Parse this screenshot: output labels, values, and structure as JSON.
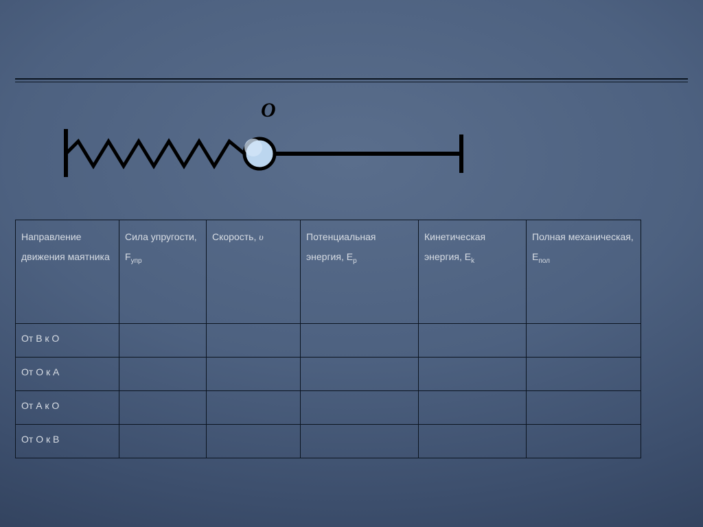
{
  "diagram": {
    "label_O": "O"
  },
  "table": {
    "headers": {
      "col1": "Направление движения маятника",
      "col2_label": "Сила упругости,",
      "col2_symbol": "F",
      "col2_sub": "упр",
      "col3_label": "Скорость,",
      "col3_symbol": "υ",
      "col4_label": "Потенциальная энергия, E",
      "col4_sub": "p",
      "col5_label": "Кинетическая энергия, E",
      "col5_sub": "k",
      "col6_label": "Полная механическая,",
      "col6_symbol": "E",
      "col6_sub": "пол"
    },
    "rows": [
      {
        "label": "От В к О"
      },
      {
        "label": "От О к А"
      },
      {
        "label": "От А к О"
      },
      {
        "label": "От О к В"
      }
    ]
  }
}
